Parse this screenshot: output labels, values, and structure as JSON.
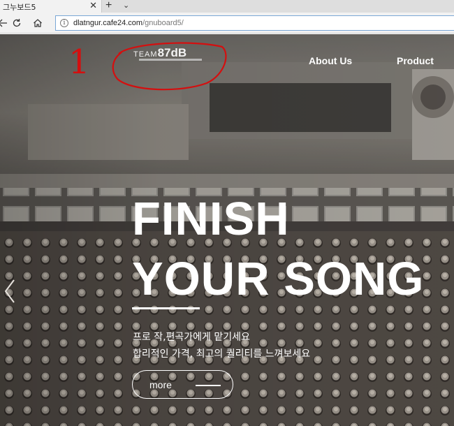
{
  "browser": {
    "tab": {
      "title": "그누보드5",
      "close_icon": "close-icon"
    },
    "new_tab_label": "+",
    "tab_list_label": "⌄",
    "address": {
      "domain": "dlatngur.cafe24.com",
      "path": "/gnuboard5/"
    }
  },
  "site": {
    "logo": {
      "brand_prefix": "TEAM",
      "brand_main": "87dB"
    },
    "nav": [
      {
        "label": "About Us"
      },
      {
        "label": "Product"
      }
    ],
    "hero": {
      "headline_line1": "FINISH",
      "headline_line2": "YOUR SONG",
      "sub_line1": "프로 작,편곡가에게 맡기세요",
      "sub_line2": "합리적인 가격, 최고의 퀄리티를 느껴보세요",
      "more_label": "more"
    }
  },
  "annotation": {
    "marker_text": "1",
    "color": "#d40f0f"
  },
  "colors": {
    "accent_annotation": "#d40f0f",
    "hero_text": "#ffffff",
    "address_border": "#7aa7d6"
  }
}
